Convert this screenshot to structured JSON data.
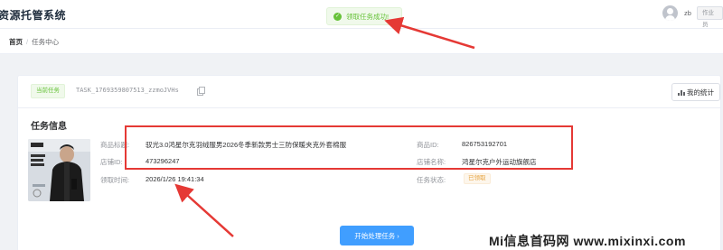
{
  "header": {
    "app_title": "资源托管系统",
    "toast": "领取任务成功!",
    "user_name": "zb",
    "user_role": "作业员"
  },
  "breadcrumb": {
    "home": "首页",
    "separator": "/",
    "current": "任务中心"
  },
  "task": {
    "current_tag": "当前任务",
    "task_id": "TASK_1769359807513_zzmoJVHs",
    "my_stats_label": "我的统计"
  },
  "info": {
    "section_title": "任务信息",
    "fields": {
      "product_title_label": "商品标题:",
      "product_title": "驭光3.0鸿星尔克羽绒服男2026冬季新款男士三防保暖夹克外套棉服",
      "product_id_label": "商品ID:",
      "product_id": "826753192701",
      "shop_id_label": "店铺ID:",
      "shop_id": "473296247",
      "shop_name_label": "店铺名称:",
      "shop_name": "鸿星尔克户外运动旗舰店",
      "claim_time_label": "领取时间:",
      "claim_time": "2026/1/26 19:41:34",
      "status_label": "任务状态:",
      "status": "已领取"
    }
  },
  "actions": {
    "start_button": "开始处理任务 ›"
  },
  "watermark": "Mi信息首码网 www.mixinxi.com",
  "colors": {
    "primary": "#409eff",
    "success": "#67c23a",
    "warning": "#e6a23c",
    "annotation": "#e53935"
  }
}
